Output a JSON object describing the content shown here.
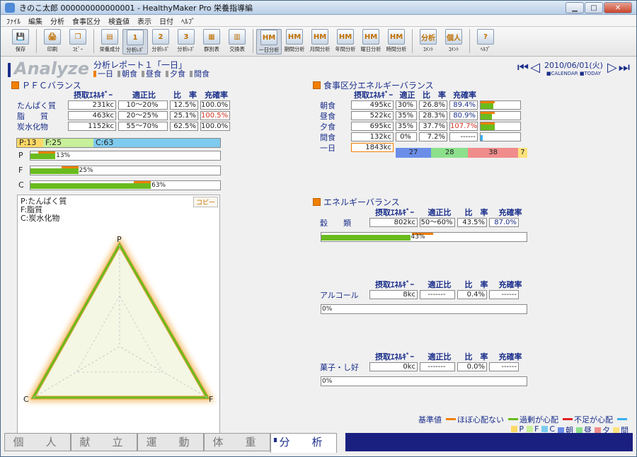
{
  "window": {
    "title": "きのこ太郎 000000000000001 - HealthyMaker Pro 栄養指導編"
  },
  "menu": [
    "ﾌｧｲﾙ",
    "編集",
    "分析",
    "食事区分",
    "検査値",
    "表示",
    "日付",
    "ﾍﾙﾌﾟ"
  ],
  "toolbar": [
    {
      "label": "保存",
      "icon": "save-icon",
      "glyph": "💾"
    },
    {
      "label": "印刷",
      "icon": "print-icon",
      "glyph": "🖨"
    },
    {
      "label": "ｺﾋﾟｰ",
      "icon": "copy-icon",
      "glyph": "❐"
    },
    {
      "label": "栄養成分",
      "icon": "nutrition-icon",
      "glyph": "▤"
    },
    {
      "label": "分析ﾚﾎﾟ",
      "icon": "report1-icon",
      "glyph": "1"
    },
    {
      "label": "分析ﾚﾎﾟ",
      "icon": "report2-icon",
      "glyph": "2"
    },
    {
      "label": "分析ﾚﾎﾟ",
      "icon": "report3-icon",
      "glyph": "3"
    },
    {
      "label": "群別表",
      "icon": "group-table-icon",
      "glyph": "▦"
    },
    {
      "label": "交換表",
      "icon": "exchange-table-icon",
      "glyph": "▥"
    },
    {
      "label": "一日分析",
      "icon": "day-analysis-icon",
      "glyph": "HM"
    },
    {
      "label": "期間分析",
      "icon": "period-analysis-icon",
      "glyph": "HM"
    },
    {
      "label": "月間分析",
      "icon": "month-analysis-icon",
      "glyph": "HM"
    },
    {
      "label": "年間分析",
      "icon": "year-analysis-icon",
      "glyph": "HM"
    },
    {
      "label": "曜日分析",
      "icon": "weekday-analysis-icon",
      "glyph": "HM"
    },
    {
      "label": "時間分析",
      "icon": "time-analysis-icon",
      "glyph": "HM"
    },
    {
      "label": "ｺﾒﾝﾄ",
      "icon": "comment-icon",
      "glyph": "分析"
    },
    {
      "label": "ｺﾒﾝﾄ",
      "icon": "personal-comment-icon",
      "glyph": "個人"
    },
    {
      "label": "ﾍﾙﾌﾟ",
      "icon": "help-icon",
      "glyph": "?"
    }
  ],
  "header": {
    "brand": "Analyze",
    "report_title": "分析レポート１「一日」",
    "tabs": [
      "一日",
      "朝食",
      "昼食",
      "夕食",
      "間食"
    ],
    "date": "2010/06/01(火)",
    "calendar": "■CALENDAR ■TODAY"
  },
  "pfc": {
    "title": "ＰＦＣバランス",
    "cols": [
      "摂取ｴﾈﾙｷﾞｰ",
      "適正比",
      "比　率",
      "充確率"
    ],
    "rows": [
      {
        "label": "たんぱく質",
        "energy": "231kc",
        "range": "10〜20%",
        "ratio": "12.5%",
        "rate": "100.0%",
        "rate_color": "normal"
      },
      {
        "label": "脂　　質",
        "energy": "463kc",
        "range": "20〜25%",
        "ratio": "25.1%",
        "rate": "100.5%",
        "rate_color": "red"
      },
      {
        "label": "炭水化物",
        "energy": "1152kc",
        "range": "55〜70%",
        "ratio": "62.5%",
        "rate": "100.0%",
        "rate_color": "normal"
      }
    ],
    "balance": [
      {
        "label": "P:13",
        "value": 13,
        "color": "#ffd966"
      },
      {
        "label": "F:25",
        "value": 25,
        "color": "#c8f09a"
      },
      {
        "label": "C:63",
        "value": 63,
        "color": "#7ecbef"
      }
    ],
    "bars": [
      {
        "label": "P",
        "pct": 13,
        "text": "13%"
      },
      {
        "label": "F",
        "pct": 25,
        "text": "25%"
      },
      {
        "label": "C",
        "pct": 63,
        "text": "63%"
      }
    ],
    "legend": [
      "P:たんぱく質",
      "F:脂質",
      "C:炭水化物"
    ],
    "copy": "コピー",
    "axes": [
      "P",
      "F",
      "C"
    ]
  },
  "meal": {
    "title": "食事区分エネルギーバランス",
    "cols": [
      "摂取ｴﾈﾙｷﾞｰ",
      "適正",
      "比　率",
      "充確率"
    ],
    "rows": [
      {
        "label": "朝食",
        "energy": "495kc",
        "range": "30%",
        "ratio": "26.8%",
        "rate": "89.4%",
        "rate_color": "blue",
        "fill": 0.894
      },
      {
        "label": "昼食",
        "energy": "522kc",
        "range": "35%",
        "ratio": "28.3%",
        "rate": "80.9%",
        "rate_color": "blue",
        "fill": 0.809
      },
      {
        "label": "夕食",
        "energy": "695kc",
        "range": "35%",
        "ratio": "37.7%",
        "rate": "107.7%",
        "rate_color": "red",
        "fill": 1.0
      },
      {
        "label": "間食",
        "energy": "132kc",
        "range": "0%",
        "ratio": "7.2%",
        "rate": "------",
        "rate_color": "normal",
        "fill": 0.0
      }
    ],
    "total_label": "一日",
    "total": "1843kc",
    "split": [
      {
        "text": "27",
        "value": 27,
        "color": "#6b8ee8"
      },
      {
        "text": "28",
        "value": 28,
        "color": "#8ce08c"
      },
      {
        "text": "38",
        "value": 38,
        "color": "#f08c8c"
      },
      {
        "text": "7",
        "value": 7,
        "color": "#ffe27a"
      }
    ]
  },
  "energy": {
    "title": "エネルギーバランス",
    "cols": [
      "摂取ｴﾈﾙｷﾞｰ",
      "適正比",
      "比　率",
      "充確率"
    ],
    "items": [
      {
        "label": "穀　　類",
        "energy": "802kc",
        "range": "50〜60%",
        "ratio": "43.5%",
        "rate": "87.0%",
        "rate_color": "blue",
        "pct": 43,
        "text": "43%"
      },
      {
        "label": "アルコール",
        "energy": "8kc",
        "range": "-------",
        "ratio": "0.4%",
        "rate": "------",
        "rate_color": "normal",
        "pct": 0,
        "text": "0%"
      },
      {
        "label": "菓子・し好",
        "energy": "0kc",
        "range": "-------",
        "ratio": "0.0%",
        "rate": "------",
        "rate_color": "normal",
        "pct": 0,
        "text": "0%"
      }
    ]
  },
  "legend": {
    "title": "基準値",
    "items": [
      {
        "label": "ほぼ心配ない",
        "color": "#f08000"
      },
      {
        "label": "過剰が心配",
        "color": "#6abb1e"
      },
      {
        "label": "不足が心配",
        "color": "#e02020"
      },
      {
        "label": "",
        "color": "#3ab0f0"
      }
    ],
    "squares": [
      {
        "label": "P",
        "color": "#ffd966"
      },
      {
        "label": "F",
        "color": "#c8f09a"
      },
      {
        "label": "C",
        "color": "#7ecbef"
      },
      {
        "label": "朝",
        "color": "#6b8ee8"
      },
      {
        "label": "昼",
        "color": "#8ce08c"
      },
      {
        "label": "夕",
        "color": "#f08c8c"
      },
      {
        "label": "間",
        "color": "#ffe27a"
      }
    ]
  },
  "bottom_tabs": [
    "個　人",
    "献　立",
    "運　動",
    "体　重",
    "分　析"
  ]
}
